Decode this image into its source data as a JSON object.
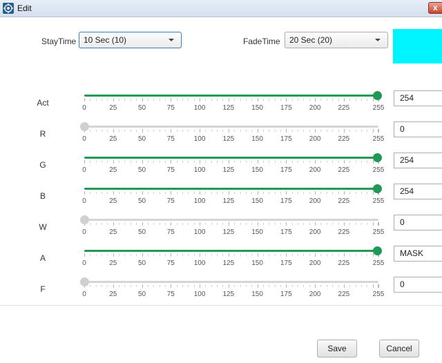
{
  "window": {
    "title": "Edit",
    "close_glyph": "x"
  },
  "timing": {
    "stay_label": "StayTime",
    "stay_value": "10 Sec (10)",
    "fade_label": "FadeTime",
    "fade_value": "20 Sec (20)"
  },
  "color_preview": "#00f5ff",
  "scale": {
    "min": 0,
    "max": 255,
    "ticks": [
      "0",
      "25",
      "50",
      "75",
      "100",
      "125",
      "150",
      "175",
      "200",
      "225",
      "255"
    ]
  },
  "channels": [
    {
      "label": "Act",
      "value": 254,
      "field": "254"
    },
    {
      "label": "R",
      "value": 0,
      "field": "0"
    },
    {
      "label": "G",
      "value": 254,
      "field": "254"
    },
    {
      "label": "B",
      "value": 254,
      "field": "254"
    },
    {
      "label": "W",
      "value": 0,
      "field": "0"
    },
    {
      "label": "A",
      "value": 254,
      "field": "MASK"
    },
    {
      "label": "F",
      "value": 0,
      "field": "0"
    }
  ],
  "buttons": {
    "save": "Save",
    "cancel": "Cancel"
  },
  "colors": {
    "accent": "#219a55",
    "track": "#d4d4d4"
  }
}
